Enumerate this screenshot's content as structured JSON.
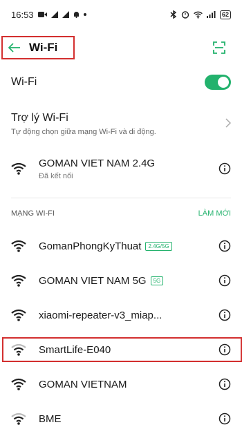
{
  "status_bar": {
    "time": "16:53",
    "battery": "62"
  },
  "header": {
    "title": "Wi-Fi"
  },
  "wifi_toggle": {
    "label": "Wi-Fi",
    "enabled": true
  },
  "wifi_assistant": {
    "title": "Trợ lý Wi-Fi",
    "subtitle": "Tự động chọn giữa mạng Wi-Fi và di động."
  },
  "connected_network": {
    "name": "GOMAN VIET NAM 2.4G",
    "status": "Đã kết nối"
  },
  "networks_section": {
    "title": "MẠNG WI-FI",
    "refresh_label": "LÀM MỚI"
  },
  "networks": [
    {
      "name": "GomanPhongKyThuat",
      "badge": "2.4G/5G",
      "signal": 3
    },
    {
      "name": "GOMAN VIET NAM 5G",
      "badge": "5G",
      "signal": 3
    },
    {
      "name": "xiaomi-repeater-v3_miap...",
      "badge": "",
      "signal": 3
    },
    {
      "name": "SmartLife-E040",
      "badge": "",
      "signal": 2,
      "highlighted": true
    },
    {
      "name": "GOMAN VIETNAM",
      "badge": "",
      "signal": 3
    },
    {
      "name": "BME",
      "badge": "",
      "signal": 2
    }
  ],
  "colors": {
    "accent": "#23b26d",
    "highlight": "#d32f2f"
  }
}
